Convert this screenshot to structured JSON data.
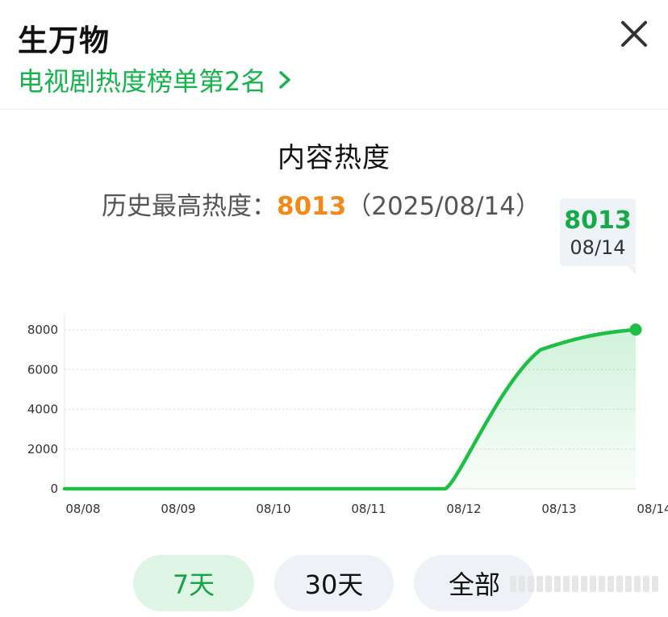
{
  "header": {
    "title": "生万物",
    "rank_text": "电视剧热度榜单第2名",
    "close_icon": "close-icon"
  },
  "section": {
    "title": "内容热度",
    "peak_label": "历史最高热度：",
    "peak_value": "8013",
    "peak_date": "（2025/08/14）"
  },
  "tooltip": {
    "value": "8013",
    "date": "08/14"
  },
  "colors": {
    "accent_green": "#16b24b",
    "peak_orange": "#f2891b",
    "button_bg": "#eef2f7",
    "button_active_bg": "#dff5e5"
  },
  "chart_data": {
    "type": "area",
    "x": [
      "08/08",
      "08/09",
      "08/10",
      "08/11",
      "08/12",
      "08/13",
      "08/14"
    ],
    "series": [
      {
        "values": [
          0,
          0,
          0,
          0,
          0,
          7000,
          8013
        ]
      }
    ],
    "yticks": [
      "8000",
      "6000",
      "4000",
      "2000",
      "0"
    ],
    "ylim": [
      0,
      8000
    ],
    "grid": true,
    "highlight_point": {
      "x": "08/14",
      "y": 8013
    }
  },
  "range_buttons": [
    {
      "label": "7天",
      "active": true
    },
    {
      "label": "30天",
      "active": false
    },
    {
      "label": "全部",
      "active": false
    }
  ]
}
